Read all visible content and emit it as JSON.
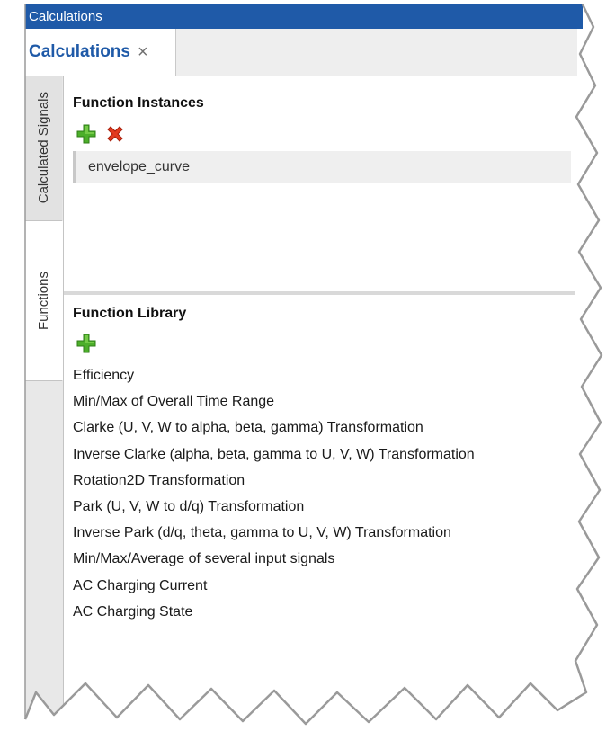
{
  "window": {
    "title": "Calculations"
  },
  "tab": {
    "label": "Calculations",
    "close_glyph": "×"
  },
  "side_tabs": [
    {
      "label": "Calculated Signals"
    },
    {
      "label": "Functions"
    }
  ],
  "instances": {
    "title": "Function Instances",
    "add_icon": "green-plus-icon",
    "remove_icon": "red-x-icon",
    "items": [
      "envelope_curve"
    ]
  },
  "library": {
    "title": "Function Library",
    "add_icon": "green-plus-icon",
    "items": [
      "Efficiency",
      "Min/Max of Overall Time Range",
      "Clarke (U, V, W to alpha, beta, gamma) Transformation",
      "Inverse Clarke (alpha, beta, gamma to U, V, W) Transformation",
      "Rotation2D Transformation",
      "Park (U, V, W to d/q) Transformation",
      "Inverse Park (d/q, theta, gamma to U, V, W) Transformation",
      "Min/Max/Average of several input signals",
      "AC Charging Current",
      "AC Charging State"
    ]
  },
  "colors": {
    "accent": "#1f5aa8",
    "add_green": "#4caf2a",
    "remove_red": "#e23a1e"
  }
}
